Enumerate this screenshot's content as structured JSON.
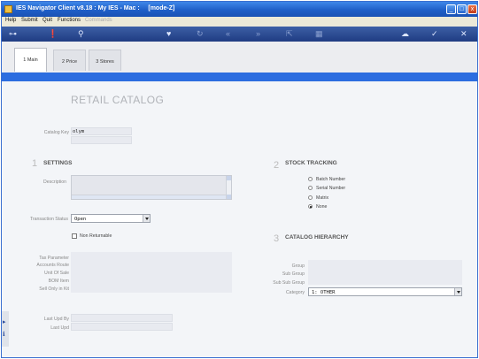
{
  "window": {
    "title": "IES Navigator Client v8.18 : My IES - Mac :     [mode-Z]"
  },
  "window_controls": {
    "minimize": "_",
    "maximize": "□",
    "close": "x"
  },
  "menu": {
    "items": [
      "Help",
      "Submit",
      "Quit",
      "Functions",
      "Commands"
    ]
  },
  "toolbar": {
    "icons": [
      "key-icon",
      "info-icon",
      "search-icon",
      "heart-icon",
      "refresh-icon",
      "rewind-icon",
      "fast-forward-icon",
      "export-icon",
      "table-icon",
      "cloud-icon",
      "check-icon",
      "close-icon"
    ]
  },
  "tabs": [
    {
      "label": "1 Main",
      "active": true
    },
    {
      "label": "2 Price",
      "active": false
    },
    {
      "label": "3 Stores",
      "active": false
    }
  ],
  "page": {
    "title": "RETAIL CATALOG"
  },
  "catalog_key": {
    "label": "Catalog Key",
    "value": "olym"
  },
  "settings": {
    "number": "1",
    "title": "SETTINGS",
    "description_label": "Description",
    "transaction_status_label": "Transaction Status",
    "transaction_status_value": "Open",
    "non_returnable_label": "Non Returnable"
  },
  "details": {
    "tax_parameter": "Tax Parameter",
    "accounts_route": "Accounts Route",
    "unit_of_sale": "Unit Of Sale",
    "bom_item": "BOM Item",
    "sell_only_in_kit": "Sell Only in Kit"
  },
  "audit": {
    "last_upd_by": "Last Upd By",
    "last_upd": "Last Upd"
  },
  "stock_tracking": {
    "number": "2",
    "title": "STOCK TRACKING",
    "options": [
      "Batch Number",
      "Serial Number",
      "Matrix",
      "None"
    ],
    "selected": "None"
  },
  "catalog_hierarchy": {
    "number": "3",
    "title": "CATALOG HIERARCHY",
    "group_label": "Group",
    "sub_group_label": "Sub Group",
    "sub_sub_group_label": "Sub Sub Group",
    "category_label": "Category",
    "category_value": "1: OTHER"
  },
  "colors": {
    "accent": "#2c6de0",
    "titlebar": "#1f5fc8",
    "toolbar": "#1f3c82"
  }
}
